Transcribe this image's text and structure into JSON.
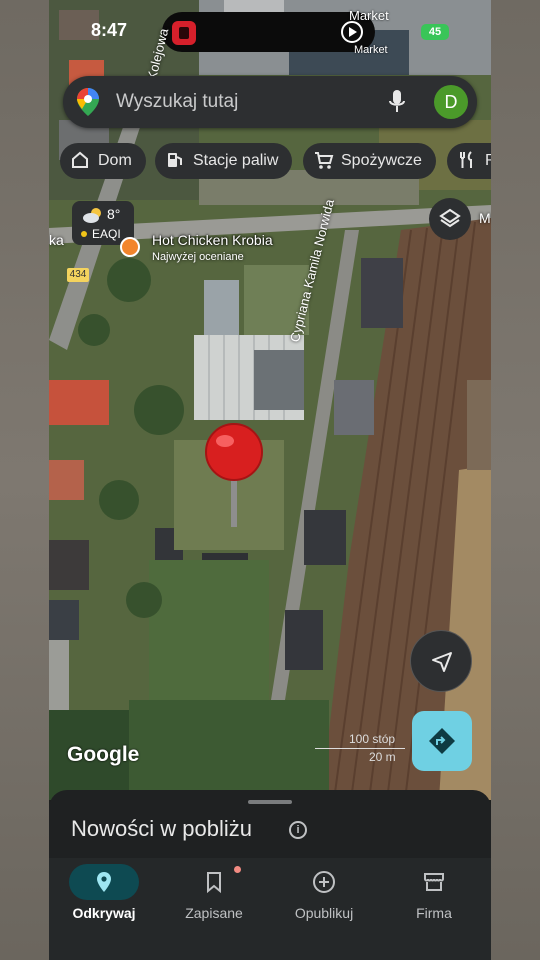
{
  "status": {
    "time": "8:47",
    "battery": "45"
  },
  "map_labels": {
    "store_top": "Market",
    "store_top2": "Market",
    "left_edge": "ka",
    "right_edge": "M",
    "street_top": "Kolejowa",
    "street_main": "Cypriana Kamila Norwida",
    "road_number": "434"
  },
  "search": {
    "placeholder": "Wyszukaj tutaj",
    "avatar_letter": "D"
  },
  "chips": [
    {
      "label": "Dom",
      "icon": "home-icon"
    },
    {
      "label": "Stacje paliw",
      "icon": "gas-station-icon"
    },
    {
      "label": "Spożywcze",
      "icon": "cart-icon"
    },
    {
      "label": "R",
      "icon": "restaurant-icon"
    }
  ],
  "weather": {
    "temp": "8°",
    "aqi": "EAQI"
  },
  "poi": {
    "name": "Hot Chicken Krobia",
    "subtitle": "Najwyżej oceniane"
  },
  "map_footer": {
    "logo": "Google",
    "scale_ft": "100 stóp",
    "scale_m": "20 m"
  },
  "sheet": {
    "title": "Nowości w pobliżu"
  },
  "nav": [
    {
      "label": "Odkrywaj",
      "icon": "location-pin-icon",
      "active": true
    },
    {
      "label": "Zapisane",
      "icon": "bookmark-icon",
      "active": false
    },
    {
      "label": "Opublikuj",
      "icon": "add-circle-icon",
      "active": false
    },
    {
      "label": "Firma",
      "icon": "store-icon",
      "active": false
    }
  ],
  "colors": {
    "accent": "#6fd0e3",
    "nav_active_bg": "#0e4a52",
    "avatar": "#4b9a2a"
  }
}
